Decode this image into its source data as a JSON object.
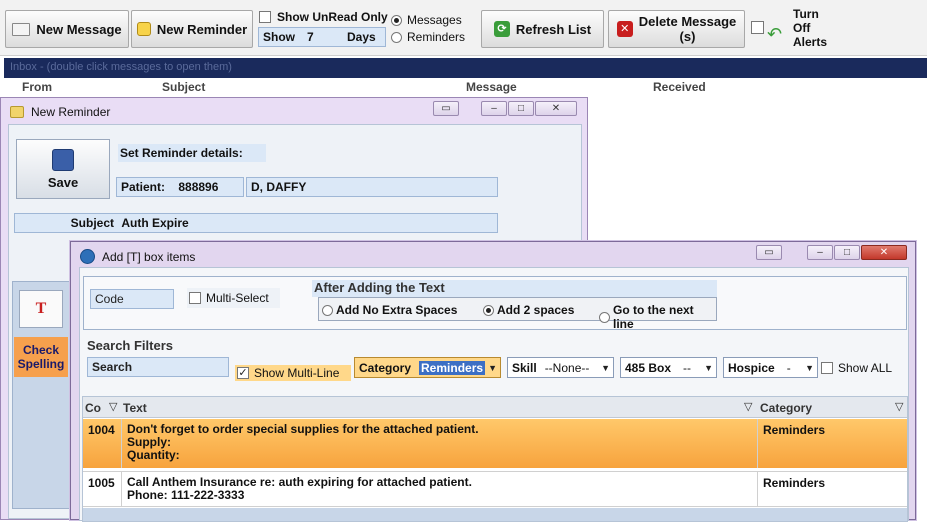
{
  "toolbar": {
    "new_message": "New Message",
    "new_reminder": "New Reminder",
    "show_unread_only": "Show UnRead Only",
    "show_prefix": "Show",
    "show_days_value": "7",
    "show_days_suffix": "Days",
    "radio_messages": "Messages",
    "radio_reminders": "Reminders",
    "refresh_list": "Refresh List",
    "delete_message_line1": "Delete Message",
    "delete_message_line2": "(s)",
    "turn_off_alerts_line1": "Turn",
    "turn_off_alerts_line2": "Off",
    "turn_off_alerts_line3": "Alerts"
  },
  "inbox": {
    "hint": "Inbox - (double click messages to open them)",
    "columns": [
      "From",
      "Subject",
      "Message",
      "Received"
    ]
  },
  "new_reminder_window": {
    "title": "New Reminder",
    "save_label": "Save",
    "set_details_label": "Set Reminder details:",
    "patient_label": "Patient:",
    "patient_id": "888896",
    "patient_name": "D, DAFFY",
    "subject_label": "Subject",
    "subject_value": "Auth Expire",
    "check_spelling_line1": "Check",
    "check_spelling_line2": "Spelling"
  },
  "add_box_window": {
    "title": "Add [T] box items",
    "code_placeholder": "Code",
    "multi_select_label": "Multi-Select",
    "after_adding_label": "After Adding the Text",
    "option_no_spaces": "Add No Extra Spaces",
    "option_two_spaces": "Add 2 spaces",
    "option_next_line": "Go to the next line",
    "search_filters_label": "Search Filters",
    "search_placeholder": "Search",
    "show_multiline_label": "Show Multi-Line",
    "category_label": "Category",
    "category_value": "Reminders",
    "skill_label": "Skill",
    "skill_value": "--None--",
    "box485_label": "485 Box",
    "box485_value": "--",
    "hospice_label": "Hospice",
    "hospice_value": "-",
    "show_all_label": "Show ALL",
    "grid_headers": {
      "code": "Co",
      "text": "Text",
      "category": "Category"
    },
    "rows": [
      {
        "code": "1004",
        "text_lines": [
          "Don't forget to order special supplies for the attached patient.",
          "Supply:",
          "Quantity:"
        ],
        "category": "Reminders",
        "selected": true
      },
      {
        "code": "1005",
        "text_lines": [
          "Call Anthem Insurance re: auth expiring for attached patient.",
          "Phone: 111-222-3333"
        ],
        "category": "Reminders",
        "selected": false
      }
    ]
  },
  "colors": {
    "accent_orange": "#ffb347",
    "field_blue": "#dbe8f7",
    "title_purple": "#e9ddf5",
    "header_navy": "#1a2a5c"
  }
}
